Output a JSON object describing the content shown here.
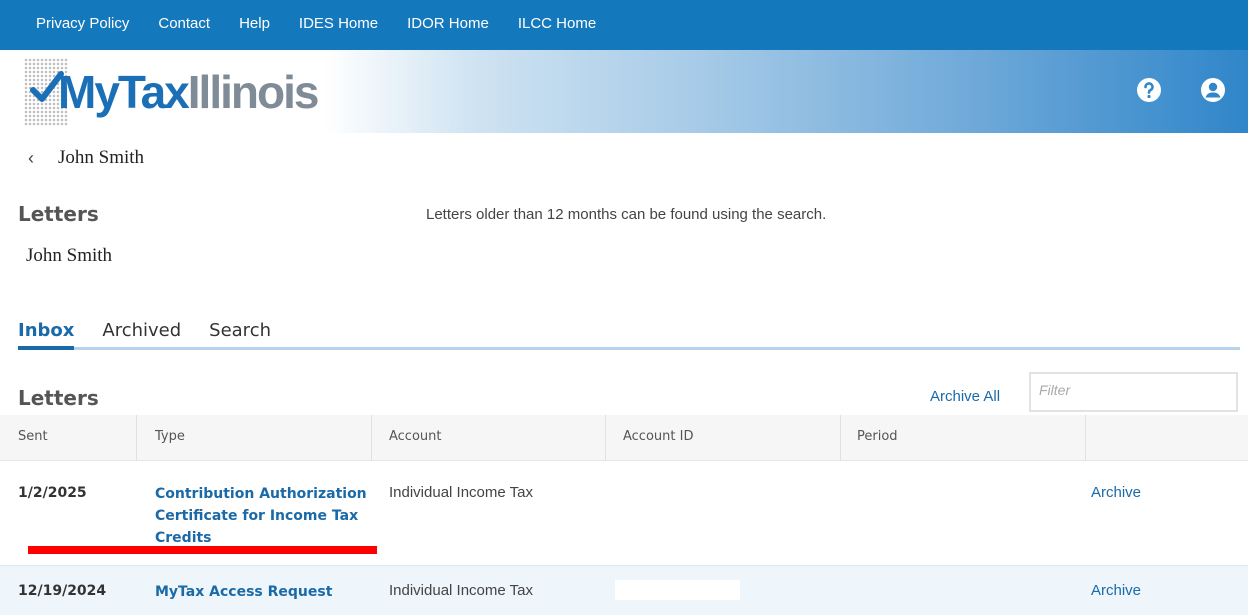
{
  "topnav": {
    "links": [
      "Privacy Policy",
      "Contact",
      "Help",
      "IDES Home",
      "IDOR Home",
      "ILCC Home"
    ]
  },
  "header": {
    "logo_my": "MyTax",
    "logo_state": "Illinois",
    "icons": [
      "help-icon",
      "user-account-icon"
    ]
  },
  "breadcrumb": {
    "back_name": "John Smith"
  },
  "page": {
    "title": "Letters",
    "subname": "John Smith",
    "notice": "Letters older than 12 months can be found using the search."
  },
  "tabs": [
    "Inbox",
    "Archived",
    "Search"
  ],
  "letters": {
    "title": "Letters",
    "archive_all": "Archive All",
    "filter_placeholder": "Filter",
    "columns": [
      "Sent",
      "Type",
      "Account",
      "Account ID",
      "Period"
    ],
    "rows": [
      {
        "sent": "1/2/2025",
        "type_line1": "Contribution Authorization",
        "type_line2": "Certificate for Income Tax",
        "type_line3": "Credits",
        "account": "Individual Income Tax",
        "action": "Archive"
      },
      {
        "sent": "12/19/2024",
        "type_line1": "MyTax Access Request",
        "account": "Individual Income Tax",
        "action": "Archive"
      }
    ]
  },
  "colors": {
    "nav_blue": "#1478bd",
    "link_blue": "#1a6aa8",
    "highlight_red": "#ff0000"
  }
}
